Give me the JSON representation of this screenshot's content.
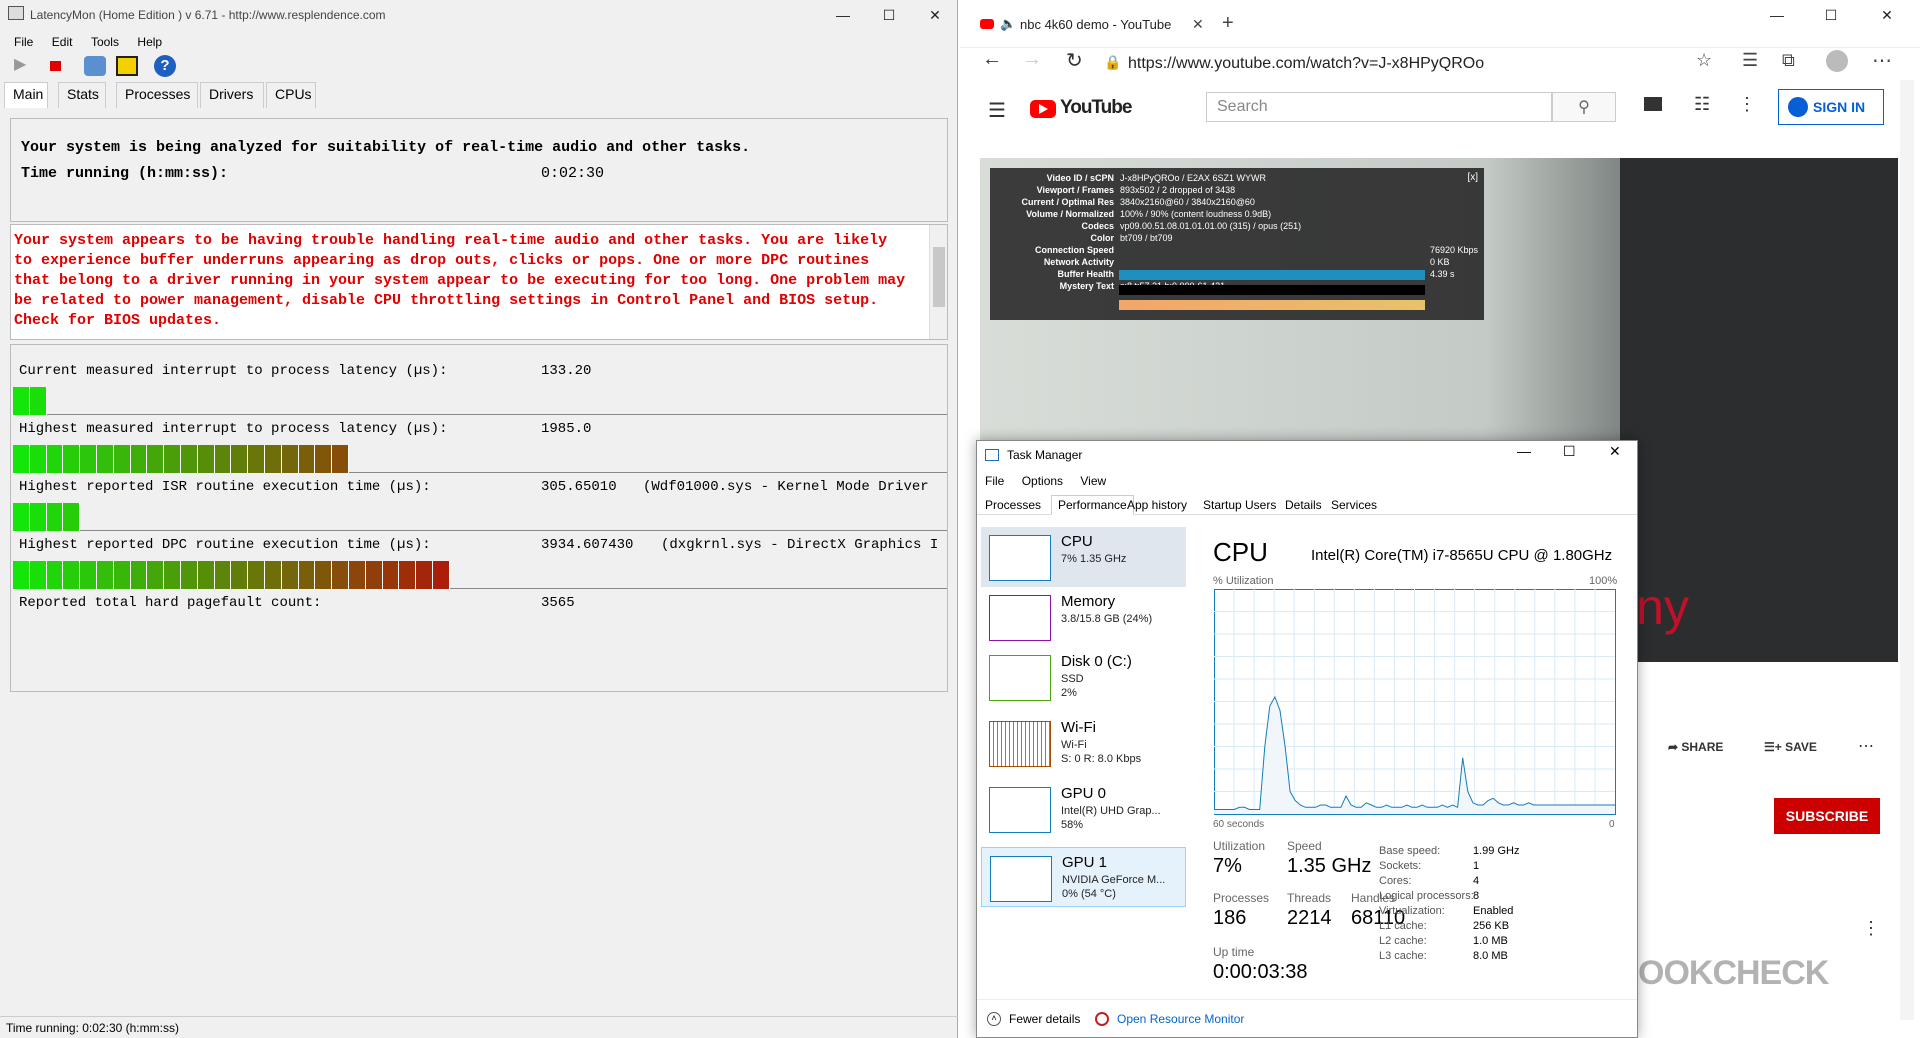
{
  "latencymon": {
    "title": "LatencyMon  (Home Edition )  v 6.71 - http://www.resplendence.com",
    "menu": [
      "File",
      "Edit",
      "Tools",
      "Help"
    ],
    "tabs": [
      "Main",
      "Stats",
      "Processes",
      "Drivers",
      "CPUs"
    ],
    "analyzing": "Your system is being analyzed for suitability of real-time audio and other tasks.",
    "time_label": "Time running (h:mm:ss):",
    "time_value": "0:02:30",
    "warning": "Your system appears to be having trouble handling real-time audio and other tasks. You are likely to experience buffer underruns appearing as drop outs, clicks or pops. One or more DPC routines that belong to a driver running in your system appear to be executing for too long. One problem may be related to power management, disable CPU throttling settings in Control Panel and BIOS setup. Check for BIOS updates.",
    "metrics": [
      {
        "label": "Current measured interrupt to process latency (µs):",
        "value": "133.20",
        "extra": "",
        "segments": 2
      },
      {
        "label": "Highest measured interrupt to process latency (µs):",
        "value": "1985.0",
        "extra": "",
        "segments": 20
      },
      {
        "label": "Highest reported ISR routine execution time (µs):",
        "value": "305.65010",
        "extra": "(Wdf01000.sys - Kernel Mode Driver",
        "segments": 4
      },
      {
        "label": "Highest reported DPC routine execution time (µs):",
        "value": "3934.607430",
        "extra": "(dxgkrnl.sys - DirectX Graphics I",
        "segments": 26
      }
    ],
    "pagefault_label": "Reported total hard pagefault count:",
    "pagefault_value": "3565",
    "status": "Time running: 0:02:30  (h:mm:ss)"
  },
  "browser": {
    "tab_title": "nbc 4k60 demo - YouTube",
    "url": "https://www.youtube.com/watch?v=J-x8HPyQROo",
    "youtube_logo": "YouTube",
    "search_placeholder": "Search",
    "sign_in": "SIGN IN",
    "share": "SHARE",
    "save": "SAVE",
    "subscribe": "SUBSCRIBE",
    "stats": [
      {
        "k": "Video ID / sCPN",
        "v": "J-x8HPyQROo / E2AX 6SZ1 WYWR"
      },
      {
        "k": "Viewport / Frames",
        "v": "893x502 / 2 dropped of 3438"
      },
      {
        "k": "Current / Optimal Res",
        "v": "3840x2160@60 / 3840x2160@60"
      },
      {
        "k": "Volume / Normalized",
        "v": "100% / 90% (content loudness 0.9dB)"
      },
      {
        "k": "Codecs",
        "v": "vp09.00.51.08.01.01.01.00 (315) / opus (251)"
      },
      {
        "k": "Color",
        "v": "bt709 / bt709"
      },
      {
        "k": "Connection Speed",
        "v": "76920 Kbps"
      },
      {
        "k": "Network Activity",
        "v": "0 KB"
      },
      {
        "k": "Buffer Health",
        "v": "4.39 s"
      },
      {
        "k": "Mystery Text",
        "v": "s:8 t:57.21 b:0.000-61.421"
      }
    ],
    "stats_close": "[x]",
    "video_overlay_text": "Pony",
    "watermark": "NOTEBOOKCHECK"
  },
  "taskmanager": {
    "title": "Task Manager",
    "menu": [
      "File",
      "Options",
      "View"
    ],
    "tabs": [
      "Processes",
      "Performance",
      "App history",
      "Startup",
      "Users",
      "Details",
      "Services"
    ],
    "sidebar": [
      {
        "name": "CPU",
        "sub1": "7% 1.35 GHz",
        "sub2": "",
        "sub3": "",
        "color": "#117dbb"
      },
      {
        "name": "Memory",
        "sub1": "3.8/15.8 GB (24%)",
        "sub2": "",
        "sub3": "",
        "color": "#8b12ae"
      },
      {
        "name": "Disk 0 (C:)",
        "sub1": "SSD",
        "sub2": "2%",
        "sub3": "",
        "color": "#4da60c"
      },
      {
        "name": "Wi-Fi",
        "sub1": "Wi-Fi",
        "sub2": "S: 0 R: 8.0 Kbps",
        "sub3": "",
        "color": "#a74f01"
      },
      {
        "name": "GPU 0",
        "sub1": "Intel(R) UHD Grap...",
        "sub2": "58%",
        "sub3": "",
        "color": "#117dbb"
      },
      {
        "name": "GPU 1",
        "sub1": "NVIDIA GeForce M...",
        "sub2": "0% (54 °C)",
        "sub3": "",
        "color": "#117dbb"
      }
    ],
    "cpu_heading": "CPU",
    "cpu_model": "Intel(R) Core(TM) i7-8565U CPU @ 1.80GHz",
    "util_label": "% Utilization",
    "util_max": "100%",
    "time_left": "60 seconds",
    "time_right": "0",
    "utilization_label": "Utilization",
    "utilization_value": "7%",
    "speed_label": "Speed",
    "speed_value": "1.35 GHz",
    "processes_label": "Processes",
    "processes_value": "186",
    "threads_label": "Threads",
    "threads_value": "2214",
    "handles_label": "Handles",
    "handles_value": "68110",
    "uptime_label": "Up time",
    "uptime_value": "0:00:03:38",
    "specs": [
      {
        "k": "Base speed:",
        "v": "1.99 GHz"
      },
      {
        "k": "Sockets:",
        "v": "1"
      },
      {
        "k": "Cores:",
        "v": "4"
      },
      {
        "k": "Logical processors:",
        "v": "8"
      },
      {
        "k": "Virtualization:",
        "v": "Enabled"
      },
      {
        "k": "L1 cache:",
        "v": "256 KB"
      },
      {
        "k": "L2 cache:",
        "v": "1.0 MB"
      },
      {
        "k": "L3 cache:",
        "v": "8.0 MB"
      }
    ],
    "fewer_details": "Fewer details",
    "open_resource_monitor": "Open Resource Monitor",
    "cpu_graph": [
      2,
      2,
      2,
      2,
      2,
      3,
      3,
      2,
      2,
      2,
      30,
      48,
      52,
      46,
      30,
      10,
      6,
      4,
      3,
      3,
      3,
      4,
      4,
      3,
      3,
      3,
      8,
      4,
      3,
      3,
      5,
      4,
      3,
      3,
      4,
      3,
      3,
      3,
      4,
      3,
      3,
      4,
      3,
      3,
      3,
      4,
      3,
      4,
      3,
      25,
      10,
      5,
      4,
      4,
      6,
      7,
      5,
      4,
      4,
      5,
      4,
      4,
      5,
      4,
      4,
      4,
      4,
      4,
      4,
      4,
      4,
      4,
      4,
      4,
      4,
      4,
      4,
      4,
      4,
      4
    ]
  }
}
